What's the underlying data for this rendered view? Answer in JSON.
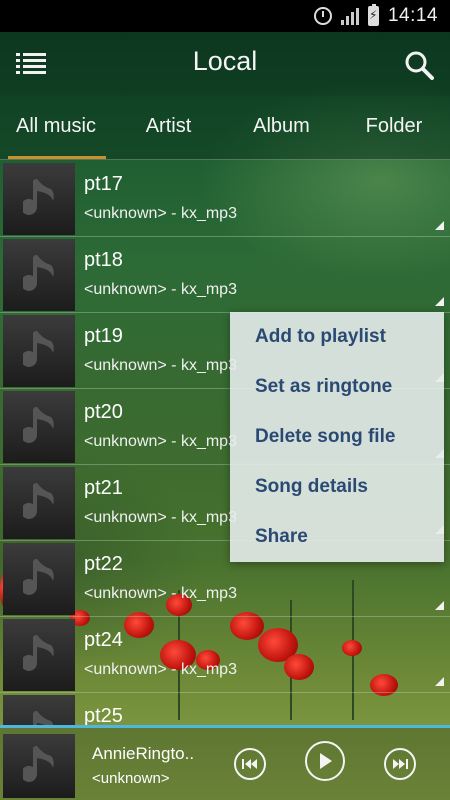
{
  "status_bar": {
    "time": "14:14"
  },
  "header": {
    "title": "Local"
  },
  "tabs": [
    {
      "label": "All music",
      "active": true
    },
    {
      "label": "Artist"
    },
    {
      "label": "Album"
    },
    {
      "label": "Folder"
    }
  ],
  "songs": [
    {
      "title": "pt17",
      "subtitle": "<unknown> - kx_mp3"
    },
    {
      "title": "pt18",
      "subtitle": "<unknown> - kx_mp3"
    },
    {
      "title": "pt19",
      "subtitle": "<unknown> - kx_mp3"
    },
    {
      "title": "pt20",
      "subtitle": "<unknown> - kx_mp3"
    },
    {
      "title": "pt21",
      "subtitle": "<unknown> - kx_mp3"
    },
    {
      "title": "pt22",
      "subtitle": "<unknown> - kx_mp3"
    },
    {
      "title": "pt24",
      "subtitle": "<unknown> - kx_mp3"
    },
    {
      "title": "pt25",
      "subtitle": ""
    }
  ],
  "context_menu": {
    "items": [
      "Add to playlist",
      "Set as ringtone",
      "Delete song file",
      "Song details",
      "Share"
    ]
  },
  "player": {
    "title": "AnnieRingto..",
    "artist": "<unknown>"
  },
  "colors": {
    "accent_underline": "#c8932e",
    "menu_text": "#2a4a73",
    "progress": "#4fb6e0"
  },
  "icons": [
    "menu-list-icon",
    "search-icon",
    "music-note-icon",
    "previous-icon",
    "play-icon",
    "next-icon"
  ]
}
